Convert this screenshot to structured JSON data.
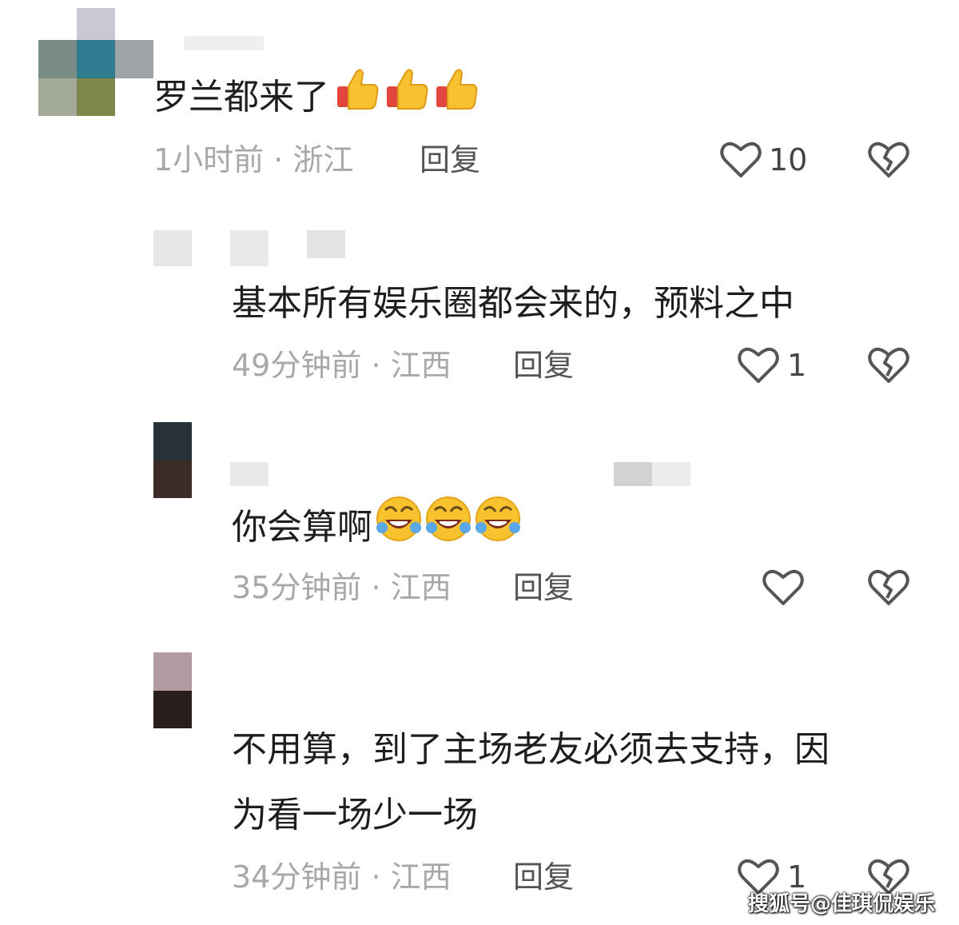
{
  "colors": {
    "background": "#ffffff",
    "text": "#1e1e1e",
    "meta": "#a8a8a8",
    "icon_stroke": "#555555"
  },
  "comments": [
    {
      "text": "罗兰都来了",
      "emoji": [
        "thumbs-up-icon",
        "thumbs-up-icon",
        "thumbs-up-icon"
      ],
      "time": "1小时前",
      "sep": "·",
      "location": "浙江",
      "reply_label": "回复",
      "likes": "10"
    },
    {
      "text": "基本所有娱乐圈都会来的，预料之中",
      "time": "49分钟前",
      "sep": "·",
      "location": "江西",
      "reply_label": "回复",
      "likes": "1"
    },
    {
      "text": "你会算啊",
      "emoji": [
        "laughing-crying-face-icon",
        "laughing-crying-face-icon",
        "laughing-crying-face-icon"
      ],
      "time": "35分钟前",
      "sep": "·",
      "location": "江西",
      "reply_label": "回复",
      "likes": ""
    },
    {
      "text_line1": "不用算，到了主场老友必须去支持，因",
      "text_line2": "为看一场少一场",
      "time": "34分钟前",
      "sep": "·",
      "location": "江西",
      "reply_label": "回复",
      "likes": "1"
    }
  ],
  "watermark": "搜狐号@佳琪侃娱乐"
}
